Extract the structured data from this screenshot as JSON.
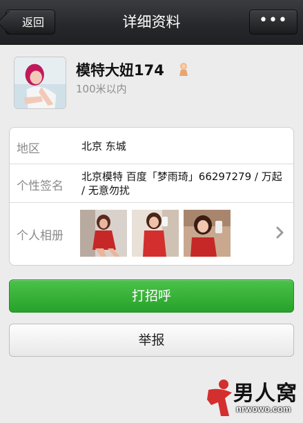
{
  "header": {
    "back_label": "返回",
    "title": "详细资料",
    "more_label": "•••"
  },
  "profile": {
    "nickname": "模特大妞174",
    "gender": "female-icon",
    "distance": "100米以内"
  },
  "info": {
    "region_label": "地区",
    "region_value": "北京  东城",
    "signature_label": "个性签名",
    "signature_value": "北京模特 百度「梦雨琦」66297279 / 万起 / 无意勿扰",
    "album_label": "个人相册",
    "album_photos": [
      "album-photo-1",
      "album-photo-2",
      "album-photo-3"
    ]
  },
  "actions": {
    "greet_label": "打招呼",
    "report_label": "举报"
  },
  "watermark": {
    "title": "男人窝",
    "url": "nrwowo.com"
  },
  "colors": {
    "topbar": "#25272a",
    "greet_button": "#2fa82f",
    "background": "#ececec"
  }
}
